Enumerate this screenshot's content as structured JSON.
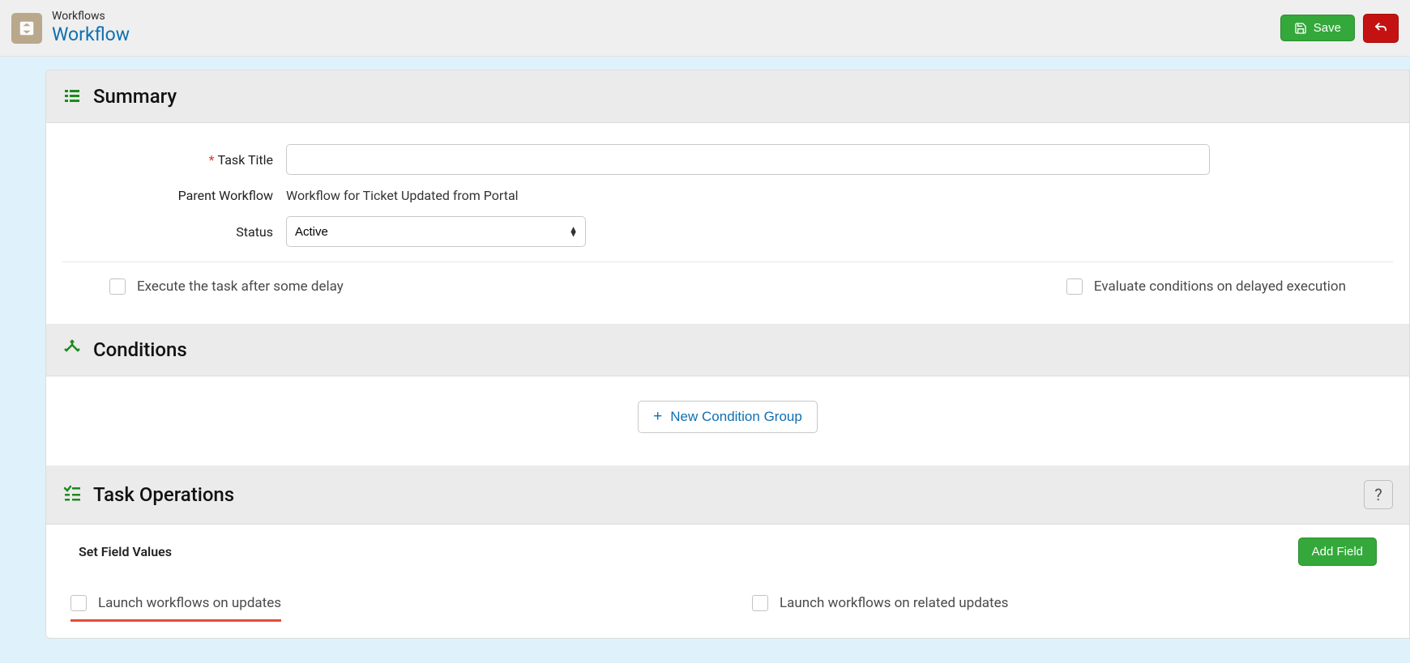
{
  "header": {
    "breadcrumb": "Workflows",
    "page_name": "Workflow",
    "save_label": "Save"
  },
  "summary": {
    "heading": "Summary",
    "task_title_label": "Task Title",
    "task_title_value": "",
    "parent_workflow_label": "Parent Workflow",
    "parent_workflow_value": "Workflow for Ticket Updated from Portal",
    "status_label": "Status",
    "status_value": "Active",
    "execute_delay_label": "Execute the task after some delay",
    "evaluate_delay_label": "Evaluate conditions on delayed execution"
  },
  "conditions": {
    "heading": "Conditions",
    "new_condition_group_label": "New Condition Group"
  },
  "operations": {
    "heading": "Task Operations",
    "set_field_values_label": "Set Field Values",
    "add_field_label": "Add Field",
    "launch_on_updates_label": "Launch workflows on updates",
    "launch_on_related_label": "Launch workflows on related updates"
  }
}
